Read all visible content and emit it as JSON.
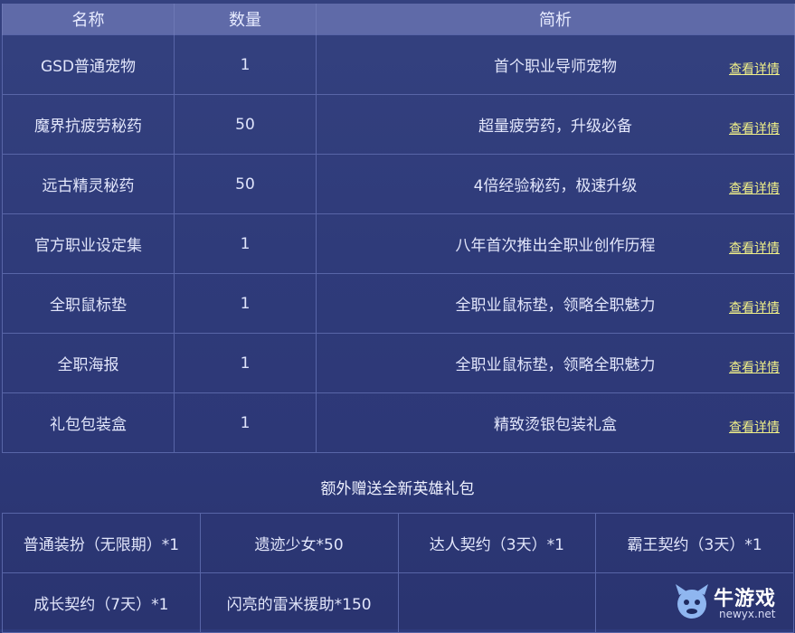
{
  "table": {
    "headers": [
      "名称",
      "数量",
      "简析"
    ],
    "rows": [
      {
        "name": "GSD普通宠物",
        "qty": "1",
        "desc": "首个职业导师宠物",
        "link": "查看详情"
      },
      {
        "name": "魔界抗疲劳秘药",
        "qty": "50",
        "desc": "超量疲劳药，升级必备",
        "link": "查看详情"
      },
      {
        "name": "远古精灵秘药",
        "qty": "50",
        "desc": "4倍经验秘药，极速升级",
        "link": "查看详情"
      },
      {
        "name": "官方职业设定集",
        "qty": "1",
        "desc": "八年首次推出全职业创作历程",
        "link": "查看详情"
      },
      {
        "name": "全职鼠标垫",
        "qty": "1",
        "desc": "全职业鼠标垫，领略全职魅力",
        "link": "查看详情"
      },
      {
        "name": "全职海报",
        "qty": "1",
        "desc": "全职业鼠标垫，领略全职魅力",
        "link": "查看详情"
      },
      {
        "name": "礼包包装盒",
        "qty": "1",
        "desc": "精致烫银包装礼盒",
        "link": "查看详情"
      }
    ]
  },
  "extra": {
    "title": "额外赠送全新英雄礼包",
    "gifts": [
      [
        "普通装扮（无限期）*1",
        "遗迹少女*50",
        "达人契约（3天）*1",
        "霸王契约（3天）*1"
      ],
      [
        "成长契约（7天）*1",
        "闪亮的雷米援助*150",
        "",
        ""
      ]
    ]
  },
  "watermark": {
    "name": "牛游戏",
    "domain": "newyx.net"
  },
  "colors": {
    "background": "#2e3a7c",
    "header": "#5f6aa8",
    "border": "#5865a7",
    "link": "#f1f088"
  }
}
